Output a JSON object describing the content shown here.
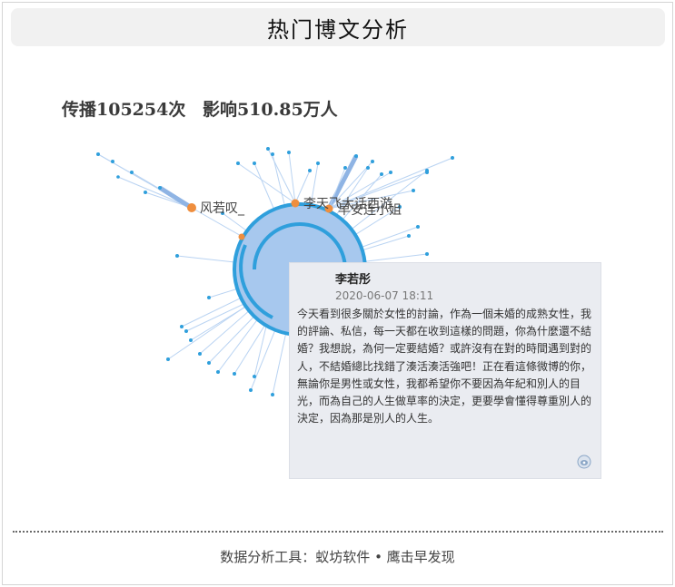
{
  "header": {
    "title": "热门博文分析"
  },
  "stats": {
    "spread": "传播105254次",
    "influence": "影响510.85万人"
  },
  "graph": {
    "colors": {
      "root": "#2f9fdc",
      "root_fill": "#a7c8ee",
      "edge": "#b9d3f2",
      "leaf": "#2f9fdc",
      "hub": "#ef8e3e",
      "label": "#444444"
    },
    "labels": [
      "风若叹_",
      "李天飞大话西游",
      "早安连小姐"
    ]
  },
  "tooltip": {
    "author": "李若彤",
    "date": "2020-06-07 18:11",
    "content": "今天看到很多關於女性的討論，作為一個未婚的成熟女性，我的評論、私信，每一天都在收到這樣的問題，你為什麼還不結婚？我想說，為何一定要結婚？或許沒有在對的時間遇到對的人，不結婚總比找錯了湊活湊活強吧！正在看這條微博的你，無論你是男性或女性，我都希望你不要因為年紀和別人的目光，而為自己的人生做草率的決定，更要學會懂得尊重別人的決定，因為那是別人的人生。",
    "icon": "weibo-icon"
  },
  "footer": {
    "text": "数据分析工具：蚁坊软件 • 鹰击早发现"
  }
}
